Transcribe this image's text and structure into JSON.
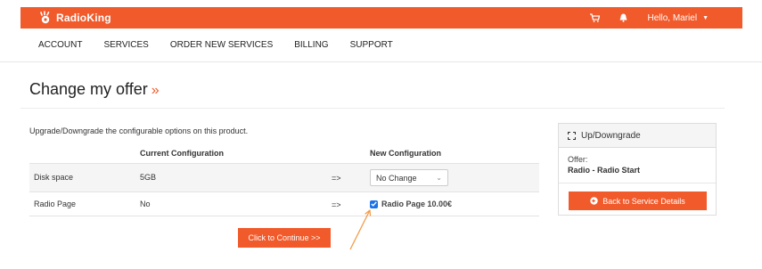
{
  "brand": {
    "name": "RadioKing"
  },
  "header": {
    "greeting": "Hello, Mariel"
  },
  "nav": {
    "items": [
      "ACCOUNT",
      "SERVICES",
      "ORDER NEW SERVICES",
      "BILLING",
      "SUPPORT"
    ]
  },
  "page": {
    "title": "Change my offer",
    "title_suffix": "»",
    "intro": "Upgrade/Downgrade the configurable options on this product."
  },
  "table": {
    "col_current": "Current Configuration",
    "col_new": "New Configuration",
    "rows": [
      {
        "label": "Disk space",
        "current": "5GB",
        "arrow": "=>",
        "new_value": "No Change"
      },
      {
        "label": "Radio Page",
        "current": "No",
        "arrow": "=>",
        "new_value": "Radio Page 10.00€",
        "checked": true
      }
    ]
  },
  "continue_button": "Click to Continue >>",
  "panel": {
    "title": "Up/Downgrade",
    "offer_label": "Offer:",
    "offer_value": "Radio - Radio Start",
    "back_button": "Back to Service Details"
  },
  "colors": {
    "accent": "#f15a2b",
    "checkbox": "#1a73e8"
  }
}
